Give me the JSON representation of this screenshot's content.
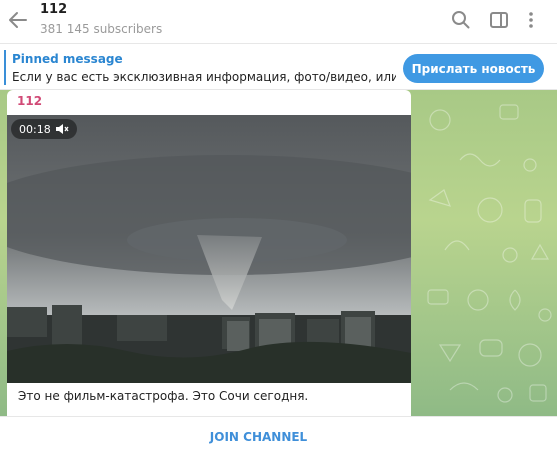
{
  "header": {
    "title": "112",
    "subscribers": "381 145 subscribers"
  },
  "pinned": {
    "label": "Pinned message",
    "text": "Если у вас есть эксклюзивная информация, фото/видео, или вы ...",
    "button": "Прислать новость"
  },
  "message": {
    "author": "112",
    "video_duration": "00:18",
    "caption": "Это не фильм-катастрофа. Это Сочи сегодня."
  },
  "footer": {
    "join_label": "JOIN CHANNEL"
  },
  "icons": {
    "back": "back-arrow-icon",
    "search": "search-icon",
    "sidebar": "sidebar-toggle-icon",
    "more": "more-vertical-icon",
    "mute": "mute-icon"
  },
  "colors": {
    "accent": "#3f99e3",
    "author": "#d14a76",
    "pinned_label": "#2b86d1"
  }
}
